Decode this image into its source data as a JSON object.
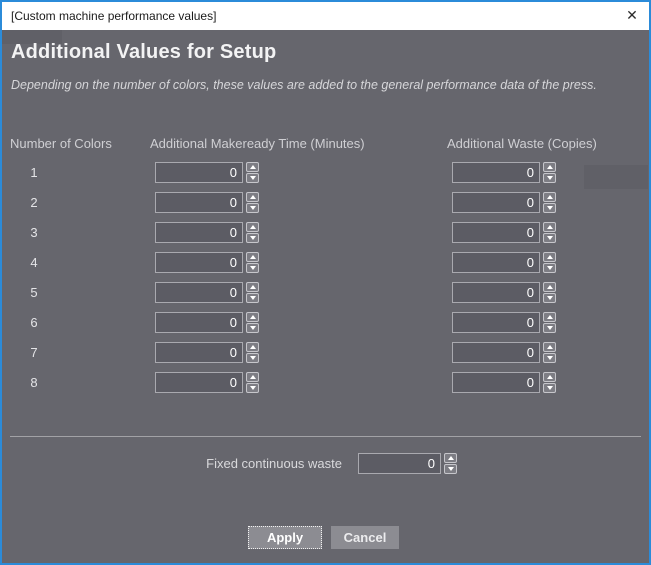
{
  "window": {
    "title": "[Custom machine performance values]",
    "close_glyph": "✕"
  },
  "heading": "Additional Values for Setup",
  "subtitle": "Depending on the number of colors, these values are added to the general performance data of the press.",
  "columns": {
    "colors": "Number of Colors",
    "makeready": "Additional Makeready Time (Minutes)",
    "waste": "Additional Waste (Copies)"
  },
  "rows": [
    {
      "number": "1",
      "makeready": "0",
      "waste": "0"
    },
    {
      "number": "2",
      "makeready": "0",
      "waste": "0"
    },
    {
      "number": "3",
      "makeready": "0",
      "waste": "0"
    },
    {
      "number": "4",
      "makeready": "0",
      "waste": "0"
    },
    {
      "number": "5",
      "makeready": "0",
      "waste": "0"
    },
    {
      "number": "6",
      "makeready": "0",
      "waste": "0"
    },
    {
      "number": "7",
      "makeready": "0",
      "waste": "0"
    },
    {
      "number": "8",
      "makeready": "0",
      "waste": "0"
    }
  ],
  "fixed_waste": {
    "label": "Fixed continuous waste",
    "value": "0"
  },
  "buttons": {
    "apply": "Apply",
    "cancel": "Cancel"
  },
  "colors": {
    "accent_border": "#2b8bd9",
    "titlebar_bg": "#ffffff",
    "dialog_bg": "#66666d",
    "field_bg": "#5c5c64",
    "field_border": "#a9a9af",
    "button_bg": "#8c8c92"
  }
}
